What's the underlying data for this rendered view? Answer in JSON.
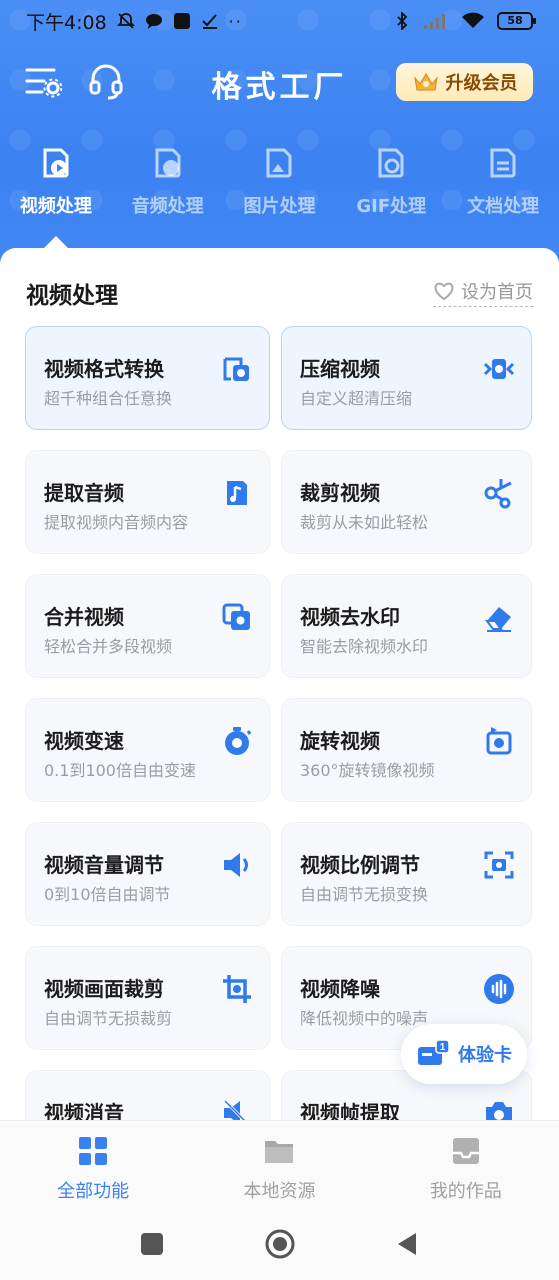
{
  "status": {
    "time": "下午4:08",
    "battery": "58"
  },
  "header": {
    "title": "格式工厂",
    "vip_label": "升级会员"
  },
  "tabs": [
    {
      "label": "视频处理",
      "active": true,
      "icon": "video-file-icon"
    },
    {
      "label": "音频处理",
      "active": false,
      "icon": "audio-file-icon"
    },
    {
      "label": "图片处理",
      "active": false,
      "icon": "image-file-icon"
    },
    {
      "label": "GIF处理",
      "active": false,
      "icon": "gif-file-icon"
    },
    {
      "label": "文档处理",
      "active": false,
      "icon": "document-file-icon"
    }
  ],
  "section": {
    "title": "视频处理",
    "set_home": "设为首页"
  },
  "tools": [
    {
      "title": "视频格式转换",
      "sub": "超千种组合任意换",
      "icon": "convert-video-icon"
    },
    {
      "title": "压缩视频",
      "sub": "自定义超清压缩",
      "icon": "compress-video-icon"
    },
    {
      "title": "提取音频",
      "sub": "提取视频内音频内容",
      "icon": "music-note-icon"
    },
    {
      "title": "裁剪视频",
      "sub": "裁剪从未如此轻松",
      "icon": "scissors-icon"
    },
    {
      "title": "合并视频",
      "sub": "轻松合并多段视频",
      "icon": "merge-video-icon"
    },
    {
      "title": "视频去水印",
      "sub": "智能去除视频水印",
      "icon": "eraser-icon"
    },
    {
      "title": "视频变速",
      "sub": "0.1到100倍自由变速",
      "icon": "stopwatch-icon"
    },
    {
      "title": "旋转视频",
      "sub": "360°旋转镜像视频",
      "icon": "rotate-video-icon"
    },
    {
      "title": "视频音量调节",
      "sub": "0到10倍自由调节",
      "icon": "speaker-icon"
    },
    {
      "title": "视频比例调节",
      "sub": "自由调节无损变换",
      "icon": "aspect-ratio-icon"
    },
    {
      "title": "视频画面裁剪",
      "sub": "自由调节无损裁剪",
      "icon": "crop-icon"
    },
    {
      "title": "视频降噪",
      "sub": "降低视频中的噪声",
      "icon": "soundwave-icon"
    },
    {
      "title": "视频消音",
      "sub": "",
      "icon": "mute-icon"
    },
    {
      "title": "视频帧提取",
      "sub": "",
      "icon": "camera-icon"
    }
  ],
  "trial": {
    "label": "体验卡",
    "badge": "1"
  },
  "bottom_nav": [
    {
      "label": "全部功能",
      "active": true,
      "icon": "grid-icon"
    },
    {
      "label": "本地资源",
      "active": false,
      "icon": "folder-icon"
    },
    {
      "label": "我的作品",
      "active": false,
      "icon": "inbox-icon"
    }
  ],
  "colors": {
    "brand_blue": "#3b82f1",
    "header_bg": "#4a8ef5",
    "vip_bg": "#fff2cf"
  }
}
